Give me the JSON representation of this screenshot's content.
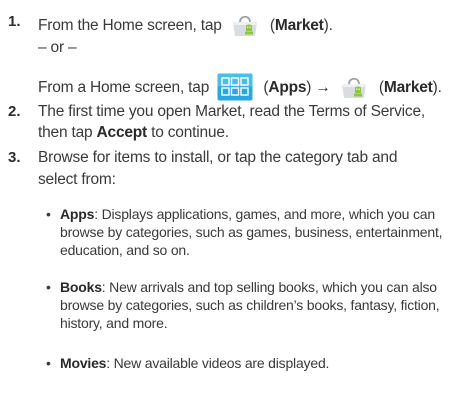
{
  "steps": [
    {
      "number": "1.",
      "line1_pre": "From the Home screen, tap",
      "line1_bold": "Market",
      "or": "– or –",
      "line3_pre": "From a Home screen, tap",
      "line3_apps": "Apps",
      "arrow": "→",
      "line3_market": "Market"
    },
    {
      "number": "2.",
      "line1": "The first time you open Market, read the Terms of Service,",
      "line2_pre": "then tap",
      "line2_bold": "Accept",
      "line2_post": "to continue."
    },
    {
      "number": "3.",
      "line1": "Browse for items to install, or tap the category tab and",
      "line2": "select from:"
    }
  ],
  "bullets": [
    {
      "term": "Apps",
      "lines": [
        ": Displays applications, games, and more, which you can",
        "browse by categories, such as games, business, entertainment,",
        "education, and so on."
      ]
    },
    {
      "term": "Books",
      "lines": [
        ": New arrivals and top selling books, which you can also",
        "browse by categories, such as children’s books, fantasy, fiction,",
        "history, and more."
      ]
    },
    {
      "term": "Movies",
      "lines": [
        ": New available videos are displayed."
      ]
    }
  ],
  "icons": [
    "market-icon",
    "apps-icon"
  ],
  "colors": {
    "text": "#3a3a3a",
    "apps_icon": "#1e9ad6",
    "market_green": "#8cc63f"
  }
}
